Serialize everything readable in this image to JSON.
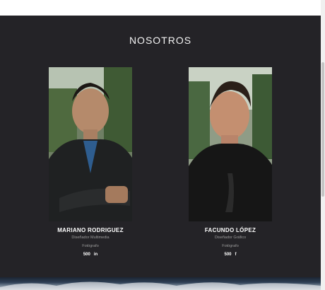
{
  "section": {
    "title": "NOSOTROS"
  },
  "members": [
    {
      "name": "MARIANO RODRIGUEZ",
      "role": "Diseñador Multimedia",
      "role2": "Fotógrafo",
      "social1": "500",
      "social2": "in"
    },
    {
      "name": "FACUNDO LÓPEZ",
      "role": "Diseñador Gráfico",
      "role2": "Fotógrafo",
      "social1": "500",
      "social2": "f"
    }
  ]
}
